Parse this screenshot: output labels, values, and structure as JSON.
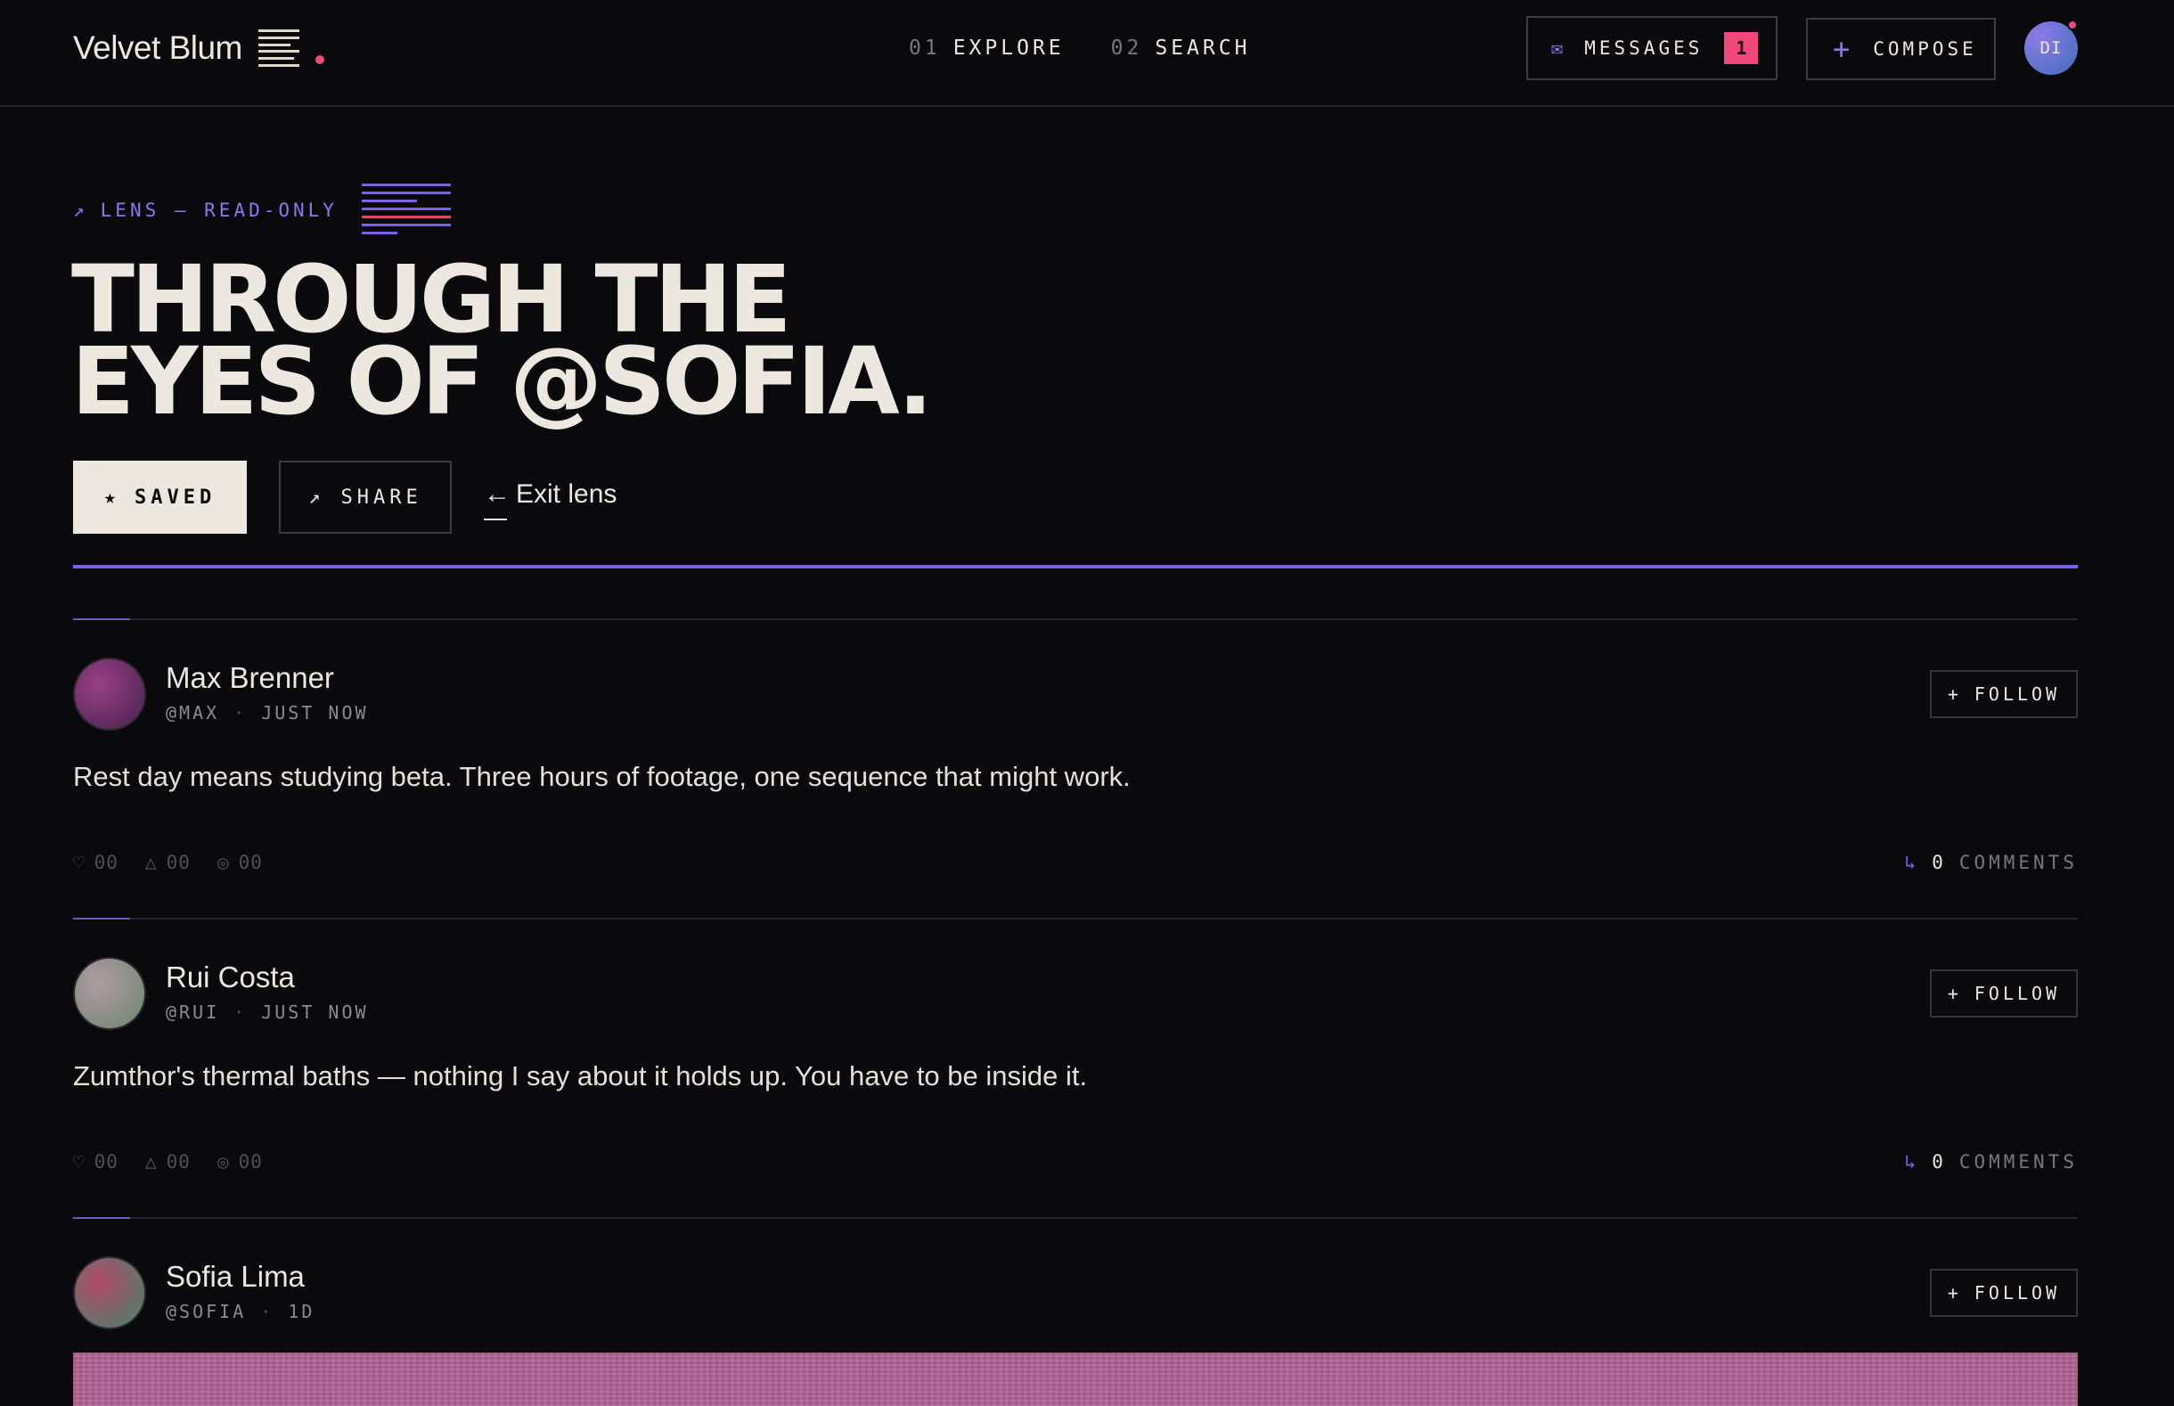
{
  "header": {
    "brand": "Velvet Blum",
    "nav": [
      {
        "num": "01",
        "label": "EXPLORE"
      },
      {
        "num": "02",
        "label": "SEARCH"
      }
    ],
    "messages_label": "MESSAGES",
    "messages_count": "1",
    "compose_label": "COMPOSE",
    "user_initials": "DI"
  },
  "lens": {
    "tag_arrow": "↗",
    "tag": "LENS — READ-ONLY",
    "title_line1": "THROUGH THE",
    "title_line2": "EYES OF @SOFIA.",
    "saved_label": "SAVED",
    "share_label": "SHARE",
    "exit_label": "Exit lens"
  },
  "colors": {
    "accent": "#7a62e8",
    "accent_light": "#8b78f0",
    "badge": "#f0487a",
    "background": "#0a0a0c",
    "text": "#ece7df"
  },
  "posts": [
    {
      "name": "Max Brenner",
      "handle": "@MAX",
      "time": "JUST NOW",
      "follow_label": "FOLLOW",
      "text": "Rest day means studying beta. Three hours of footage, one sequence that might work.",
      "likes": "00",
      "reposts": "00",
      "views": "00",
      "comments_count": "0",
      "comments_label": "COMMENTS",
      "avatar_colors": [
        "#9a3f86",
        "#5a2a5a"
      ]
    },
    {
      "name": "Rui Costa",
      "handle": "@RUI",
      "time": "JUST NOW",
      "follow_label": "FOLLOW",
      "text": "Zumthor's thermal baths — nothing I say about it holds up. You have to be inside it.",
      "likes": "00",
      "reposts": "00",
      "views": "00",
      "comments_count": "0",
      "comments_label": "COMMENTS",
      "avatar_colors": [
        "#a88a96",
        "#7a8a78"
      ]
    },
    {
      "name": "Sofia Lima",
      "handle": "@SOFIA",
      "time": "1D",
      "follow_label": "FOLLOW",
      "media_color": "#b26494",
      "avatar_colors": [
        "#b04a6a",
        "#5a7a6a"
      ]
    }
  ]
}
